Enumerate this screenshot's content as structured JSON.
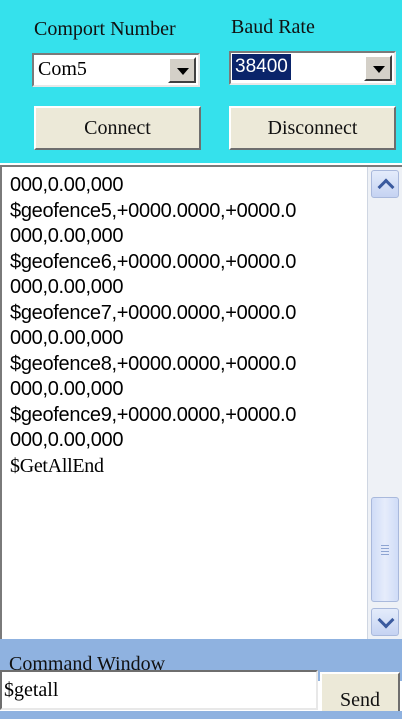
{
  "settings": {
    "comport_label": "Comport Number",
    "baud_label": "Baud Rate",
    "comport_value": "Com5",
    "baud_value": "38400",
    "connect_label": "Connect",
    "disconnect_label": "Disconnect"
  },
  "log": {
    "lines": [
      "000,0.00,000",
      "$geofence5,+0000.0000,+0000.0",
      "000,0.00,000",
      "$geofence6,+0000.0000,+0000.0",
      "000,0.00,000",
      "$geofence7,+0000.0000,+0000.0",
      "000,0.00,000",
      "$geofence8,+0000.0000,+0000.0",
      "000,0.00,000",
      "$geofence9,+0000.0000,+0000.0",
      "000,0.00,000",
      "$GetAllEnd"
    ]
  },
  "command": {
    "title": "Command Window",
    "input_value": "$getall",
    "send_label": "Send"
  },
  "colors": {
    "top_panel": "#35e1ec",
    "command_panel": "#8fb2e0",
    "selection": "#0a246a"
  }
}
